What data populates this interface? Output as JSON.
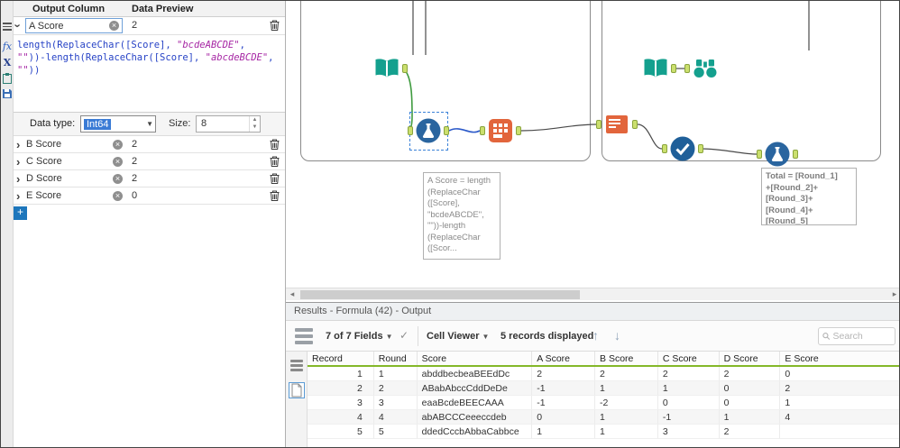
{
  "config_panel": {
    "header": {
      "output_column": "Output Column",
      "data_preview": "Data Preview"
    },
    "active_field": {
      "name": "A Score",
      "preview": "2"
    },
    "formula_lines": [
      [
        {
          "c": "code",
          "t": "length(ReplaceChar([Score], "
        },
        {
          "c": "str",
          "t": "\"bcdeABCDE\""
        },
        {
          "c": "code",
          "t": ","
        }
      ],
      [
        {
          "c": "str",
          "t": "\"\""
        },
        {
          "c": "code",
          "t": "))-length(ReplaceChar([Score], "
        },
        {
          "c": "str",
          "t": "\"abcdeBCDE\""
        },
        {
          "c": "code",
          "t": ","
        }
      ],
      [
        {
          "c": "str",
          "t": "\"\""
        },
        {
          "c": "code",
          "t": "))"
        }
      ]
    ],
    "data_type": {
      "label": "Data type:",
      "value": "Int64"
    },
    "size": {
      "label": "Size:",
      "value": "8"
    },
    "fields": [
      {
        "name": "B Score",
        "preview": "2"
      },
      {
        "name": "C Score",
        "preview": "2"
      },
      {
        "name": "D Score",
        "preview": "2"
      },
      {
        "name": "E Score",
        "preview": "0"
      }
    ],
    "add_button": "+"
  },
  "canvas": {
    "tools": [
      "input-data",
      "formula",
      "crosstab",
      "arrange",
      "unique",
      "formula-2",
      "input-data-2",
      "browse"
    ],
    "annotations": {
      "formula_note": "A Score = length\n(ReplaceChar\n([Score],\n\"bcdeABCDE\",\n\"\"))-length\n(ReplaceChar\n([Scor...",
      "total_note": "Total = [Round_1]\n+[Round_2]+\n[Round_3]+\n[Round_4]+\n[Round_5]"
    },
    "colors": {
      "teal": "#14a08e",
      "blue": "#2a659f",
      "orange": "#e2653c",
      "anchor_green": "#cbdf6e",
      "wire_green": "#3f9b3f",
      "wire_blue": "#2b59c9"
    }
  },
  "results": {
    "title": "Results - Formula (42) - Output",
    "toolbar": {
      "fields_summary": "7 of 7 Fields",
      "cell_viewer": "Cell Viewer",
      "records_summary": "5 records displayed",
      "search_placeholder": "Search"
    },
    "table": {
      "columns": [
        "Record",
        "Round",
        "Score",
        "A Score",
        "B Score",
        "C Score",
        "D Score",
        "E Score"
      ],
      "rows": [
        [
          "1",
          "1",
          "abddbecbeaBEEdDc",
          "2",
          "2",
          "2",
          "2",
          "0"
        ],
        [
          "2",
          "2",
          "ABabAbccCddDeDe",
          "-1",
          "1",
          "1",
          "0",
          "2"
        ],
        [
          "3",
          "3",
          "eaaBcdeBEECAAA",
          "-1",
          "-2",
          "0",
          "0",
          "1"
        ],
        [
          "4",
          "4",
          "abABCCCeeeccdeb",
          "0",
          "1",
          "-1",
          "1",
          "4"
        ],
        [
          "5",
          "5",
          "ddedCccbAbbaCabbce",
          "1",
          "1",
          "3",
          "2",
          ""
        ]
      ]
    }
  }
}
